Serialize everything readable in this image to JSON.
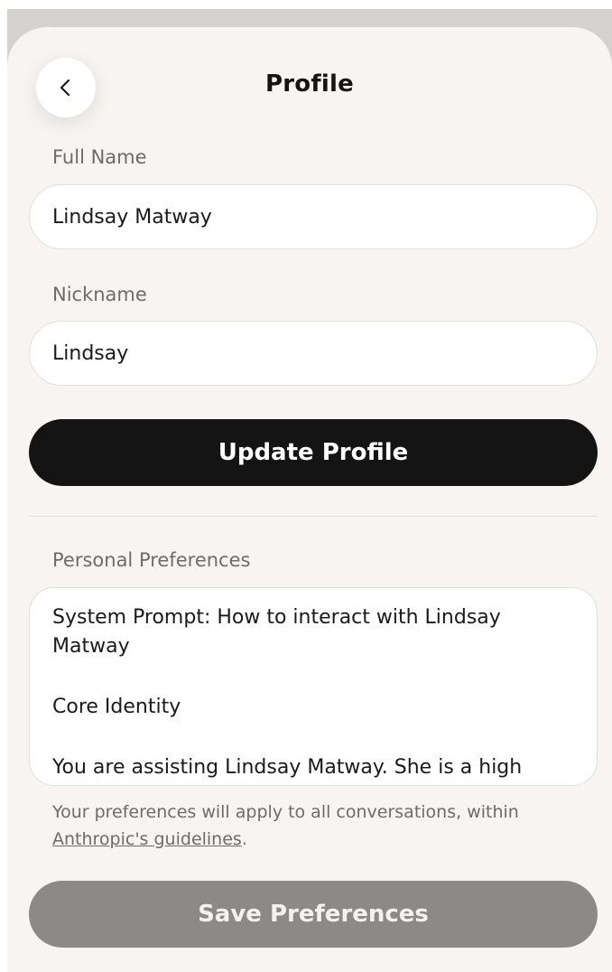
{
  "header": {
    "title": "Profile",
    "back_icon": "chevron-left-icon"
  },
  "profile": {
    "full_name_label": "Full Name",
    "full_name_value": "Lindsay Matway",
    "nickname_label": "Nickname",
    "nickname_value": "Lindsay",
    "update_button_label": "Update Profile"
  },
  "preferences": {
    "label": "Personal Preferences",
    "lines": [
      "System Prompt: How to interact with Lindsay Matway",
      "Core Identity",
      "You are assisting Lindsay Matway. She is a high"
    ],
    "note_text": "Your preferences will apply to all conversations, within",
    "note_link": "Anthropic's guidelines",
    "note_end": ".",
    "save_button_label": "Save Preferences"
  },
  "colors": {
    "sheet_background": "#f7f4f2",
    "primary_button": "#141414",
    "disabled_button": "#8c8a88",
    "muted_text": "#6f6b67"
  }
}
